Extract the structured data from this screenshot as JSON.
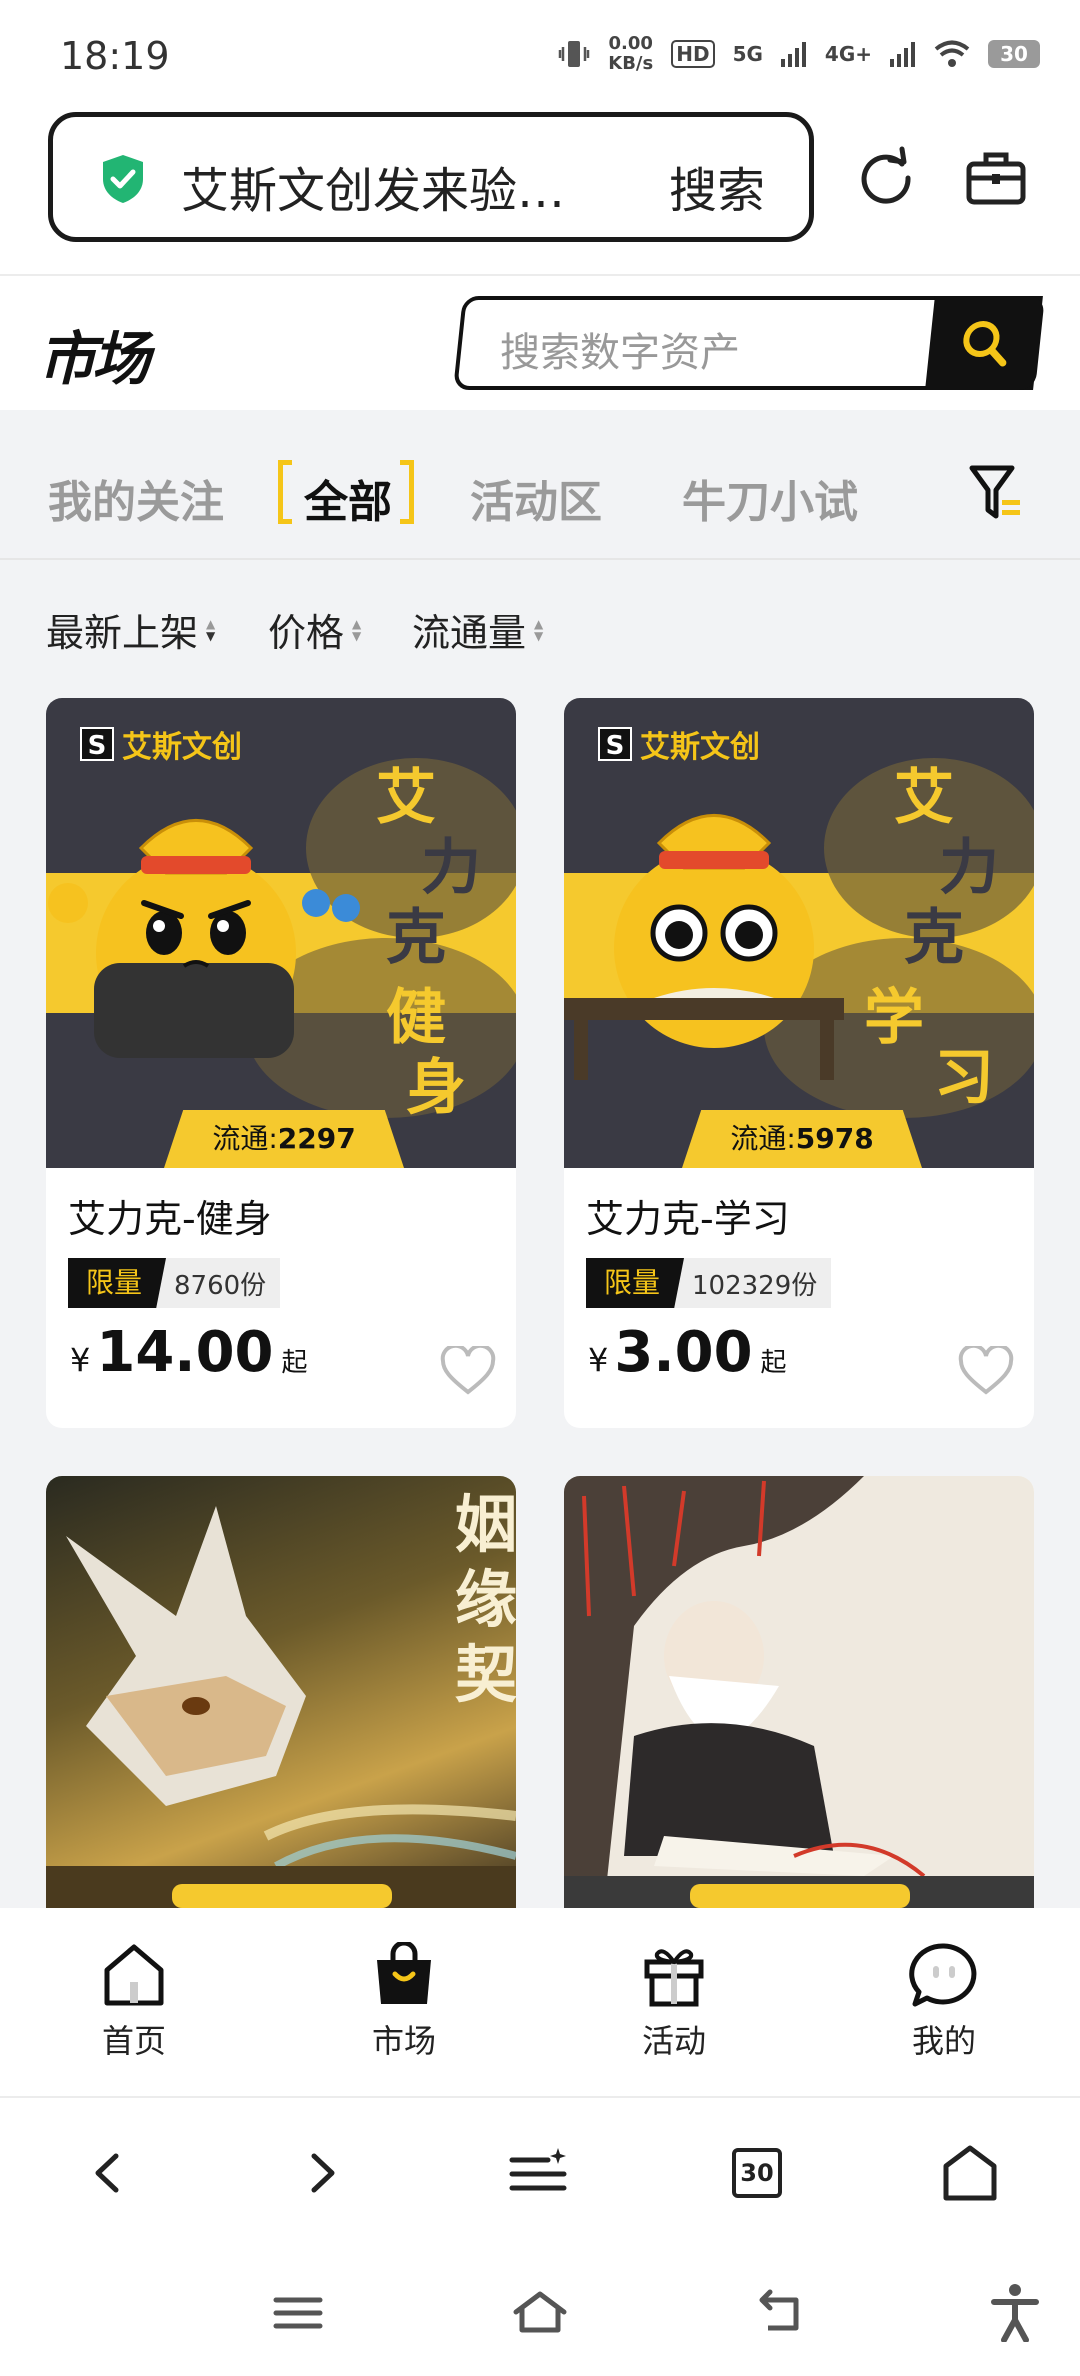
{
  "status_bar": {
    "time": "18:19",
    "speed_value": "0.00",
    "speed_unit": "KB/s",
    "hd_label": "HD",
    "net1": "5G",
    "net2": "4G+",
    "battery": "30"
  },
  "browser": {
    "url_text": "艾斯文创发来验…",
    "search_label": "搜索",
    "tab_count": "30"
  },
  "market": {
    "logo": "市场",
    "search_placeholder": "搜索数字资产"
  },
  "tabs": [
    {
      "label": "我的关注",
      "active": false
    },
    {
      "label": "全部",
      "active": true
    },
    {
      "label": "活动区",
      "active": false
    },
    {
      "label": "牛刀小试",
      "active": false
    }
  ],
  "sort": [
    {
      "label": "最新上架"
    },
    {
      "label": "价格"
    },
    {
      "label": "流通量"
    }
  ],
  "products": [
    {
      "brand": "艾斯文创",
      "art_text": [
        "艾",
        "力",
        "克",
        "健",
        "身"
      ],
      "circulation_label": "流通:",
      "circulation": "2297",
      "title": "艾力克-健身",
      "limit_label": "限量",
      "limit_qty": "8760份",
      "currency": "¥",
      "price": "14.00",
      "price_suffix": "起"
    },
    {
      "brand": "艾斯文创",
      "art_text": [
        "艾",
        "力",
        "克",
        "学",
        "习"
      ],
      "circulation_label": "流通:",
      "circulation": "5978",
      "title": "艾力克-学习",
      "limit_label": "限量",
      "limit_qty": "102329份",
      "currency": "¥",
      "price": "3.00",
      "price_suffix": "起"
    },
    {
      "art_text": [
        "姻",
        "缘",
        "契"
      ]
    },
    {
      "art_text": []
    }
  ],
  "bottom_nav": [
    {
      "label": "首页",
      "icon": "home-icon"
    },
    {
      "label": "市场",
      "icon": "shopping-bag-icon",
      "active": true
    },
    {
      "label": "活动",
      "icon": "gift-icon"
    },
    {
      "label": "我的",
      "icon": "chat-bubble-icon"
    }
  ],
  "colors": {
    "accent": "#f5c518",
    "dark": "#111111",
    "shield": "#22b573",
    "background": "#f2f3f5"
  }
}
